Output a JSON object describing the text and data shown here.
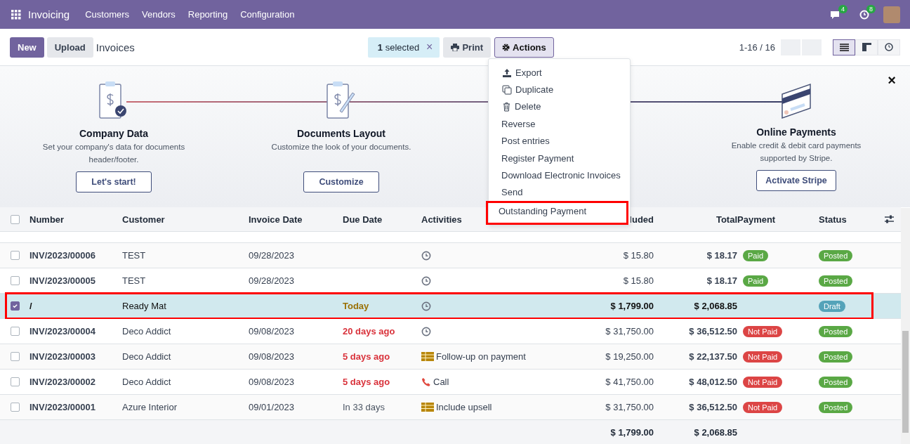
{
  "navbar": {
    "app": "Invoicing",
    "menu": [
      "Customers",
      "Vendors",
      "Reporting",
      "Configuration"
    ],
    "messages_badge": "4",
    "activities_badge": "8"
  },
  "control_panel": {
    "new": "New",
    "upload": "Upload",
    "title": "Invoices",
    "selection": "1 selected",
    "clear": "×",
    "print": "Print",
    "actions": "Actions",
    "pager": "1-16 / 16",
    "views": [
      {
        "kind": "list",
        "selected": true
      },
      {
        "kind": "kanban",
        "selected": false
      },
      {
        "kind": "activity",
        "selected": false
      }
    ]
  },
  "banner": {
    "close": "×",
    "steps": [
      {
        "kind": "check",
        "title": "Company Data",
        "text": "Set your company's data for documents header/footer.",
        "button": "Let's start!"
      },
      {
        "kind": "pen",
        "title": "Documents Layout",
        "text": "Customize the look of your documents.",
        "button": "Customize"
      },
      {
        "kind": "card",
        "title": "Online Payments",
        "text": "Enable credit & debit card payments supported by Stripe.",
        "button": "Activate Stripe"
      }
    ]
  },
  "actions_menu": [
    {
      "label": "Export",
      "kind": "export",
      "highlighted": false
    },
    {
      "label": "Duplicate",
      "kind": "duplicate",
      "highlighted": false
    },
    {
      "label": "Delete",
      "kind": "delete",
      "highlighted": false
    },
    {
      "label": "Reverse",
      "kind": "plain",
      "highlighted": false
    },
    {
      "label": "Post entries",
      "kind": "plain",
      "highlighted": false
    },
    {
      "label": "Register Payment",
      "kind": "plain",
      "highlighted": false
    },
    {
      "label": "Download Electronic Invoices",
      "kind": "plain",
      "highlighted": false
    },
    {
      "label": "Send",
      "kind": "plain",
      "highlighted": false
    },
    {
      "label": "Outstanding Payment",
      "kind": "plain",
      "highlighted": true
    }
  ],
  "table": {
    "select_all_checked": false,
    "columns": [
      "Number",
      "Customer",
      "Invoice Date",
      "Due Date",
      "Activities",
      "luded",
      "Total",
      "Payment",
      "Status"
    ],
    "rows": [
      {
        "checked": false,
        "highlighted": false,
        "number": "INV/2023/00006",
        "customer": "TEST",
        "invoice_date": "09/28/2023",
        "activity": {
          "kind": "clock"
        },
        "tax_excluded": "$ 15.80",
        "total": "$ 18.17",
        "payment": {
          "label": "Paid",
          "kind": "paid"
        },
        "status": {
          "label": "Posted",
          "kind": "posted"
        }
      },
      {
        "checked": false,
        "highlighted": false,
        "number": "INV/2023/00005",
        "customer": "TEST",
        "invoice_date": "09/28/2023",
        "activity": {
          "kind": "clock"
        },
        "tax_excluded": "$ 15.80",
        "total": "$ 18.17",
        "payment": {
          "label": "Paid",
          "kind": "paid"
        },
        "status": {
          "label": "Posted",
          "kind": "posted"
        }
      },
      {
        "checked": true,
        "highlighted": true,
        "number": "/",
        "customer": "Ready Mat",
        "due": {
          "text": "Today",
          "kind": "today"
        },
        "activity": {
          "kind": "clock"
        },
        "tax_excluded": "$ 1,799.00",
        "total": "$ 2,068.85",
        "payment": null,
        "status": {
          "label": "Draft",
          "kind": "draft"
        }
      },
      {
        "checked": false,
        "highlighted": false,
        "number": "INV/2023/00004",
        "customer": "Deco Addict",
        "invoice_date": "09/08/2023",
        "due": {
          "text": "20 days ago",
          "kind": "overdue"
        },
        "activity": {
          "kind": "clock"
        },
        "tax_excluded": "$ 31,750.00",
        "total": "$ 36,512.50",
        "payment": {
          "label": "Not Paid",
          "kind": "not_paid"
        },
        "status": {
          "label": "Posted",
          "kind": "posted"
        }
      },
      {
        "checked": false,
        "highlighted": false,
        "number": "INV/2023/00003",
        "customer": "Deco Addict",
        "invoice_date": "09/08/2023",
        "due": {
          "text": "5 days ago",
          "kind": "overdue"
        },
        "activity": {
          "kind": "todo",
          "label": "Follow-up on payment"
        },
        "tax_excluded": "$ 19,250.00",
        "total": "$ 22,137.50",
        "payment": {
          "label": "Not Paid",
          "kind": "not_paid"
        },
        "status": {
          "label": "Posted",
          "kind": "posted"
        }
      },
      {
        "checked": false,
        "highlighted": false,
        "number": "INV/2023/00002",
        "customer": "Deco Addict",
        "invoice_date": "09/08/2023",
        "due": {
          "text": "5 days ago",
          "kind": "overdue"
        },
        "activity": {
          "kind": "phone",
          "label": "Call"
        },
        "tax_excluded": "$ 41,750.00",
        "total": "$ 48,012.50",
        "payment": {
          "label": "Not Paid",
          "kind": "not_paid"
        },
        "status": {
          "label": "Posted",
          "kind": "posted"
        }
      },
      {
        "checked": false,
        "highlighted": false,
        "number": "INV/2023/00001",
        "customer": "Azure Interior",
        "invoice_date": "09/01/2023",
        "due": {
          "text": "In 33 days",
          "kind": "future"
        },
        "activity": {
          "kind": "todo",
          "label": "Include upsell"
        },
        "tax_excluded": "$ 31,750.00",
        "total": "$ 36,512.50",
        "payment": {
          "label": "Not Paid",
          "kind": "not_paid"
        },
        "status": {
          "label": "Posted",
          "kind": "posted"
        }
      }
    ],
    "footer": {
      "tax_excluded": "$ 1,799.00",
      "total": "$ 2,068.85"
    }
  }
}
